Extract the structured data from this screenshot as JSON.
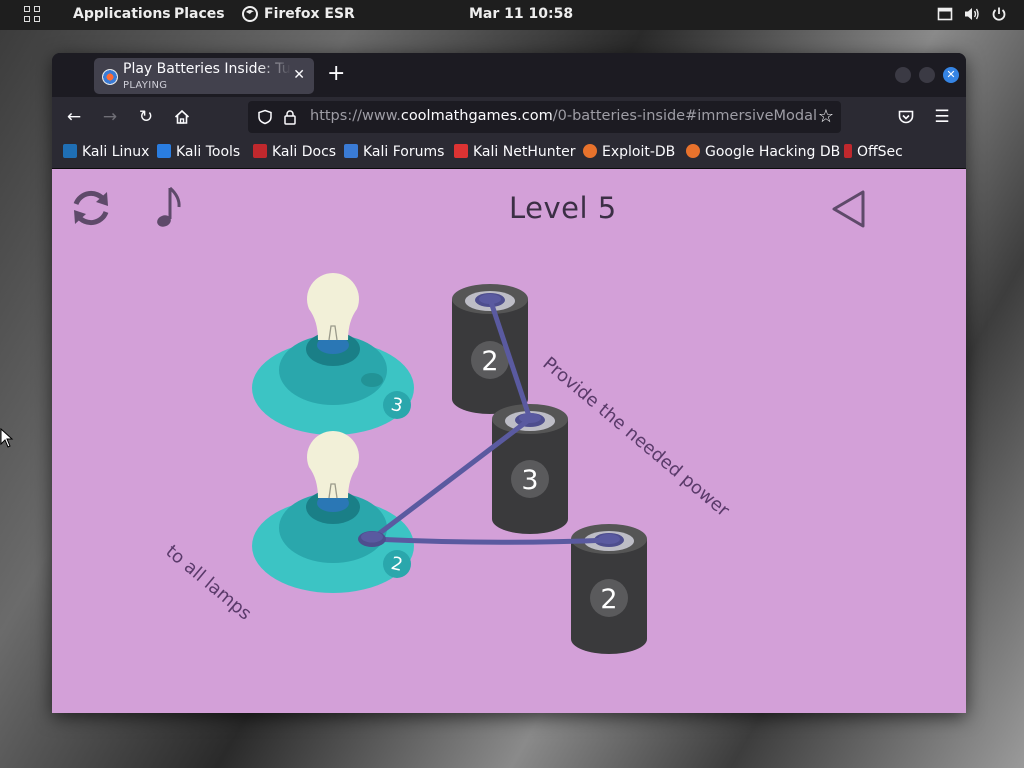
{
  "topbar": {
    "applications": "Applications",
    "places": "Places",
    "browser_app": "Firefox ESR",
    "clock": "Mar 11  10:58"
  },
  "browser": {
    "tab_title": "Play Batteries Inside: Turn",
    "tab_status": "PLAYING",
    "url_prefix": "https://www.",
    "url_domain": "coolmathgames.com",
    "url_path": "/0-batteries-inside#immersiveModal",
    "bookmarks": [
      {
        "label": "Kali Linux",
        "color": "#1f6fb5"
      },
      {
        "label": "Kali Tools",
        "color": "#2a7de1"
      },
      {
        "label": "Kali Docs",
        "color": "#c0282d"
      },
      {
        "label": "Kali Forums",
        "color": "#3a7bd5"
      },
      {
        "label": "Kali NetHunter",
        "color": "#d33"
      },
      {
        "label": "Exploit-DB",
        "color": "#e8722c"
      },
      {
        "label": "Google Hacking DB",
        "color": "#e8722c"
      },
      {
        "label": "OffSec",
        "color": "#c0282d"
      }
    ]
  },
  "game": {
    "level": "Level 5",
    "hint_top": "Provide the needed power",
    "hint_bottom": "to all lamps",
    "lamps": [
      {
        "need": "3",
        "powered": false
      },
      {
        "need": "2",
        "powered": false
      }
    ],
    "batteries": [
      {
        "charge": "2"
      },
      {
        "charge": "3"
      },
      {
        "charge": "2"
      }
    ],
    "colors": {
      "background": "#d3a0d8",
      "battery": "#3a3a3c",
      "lamp_base": "#3cc4c4",
      "wire": "#5a5aa0"
    }
  }
}
